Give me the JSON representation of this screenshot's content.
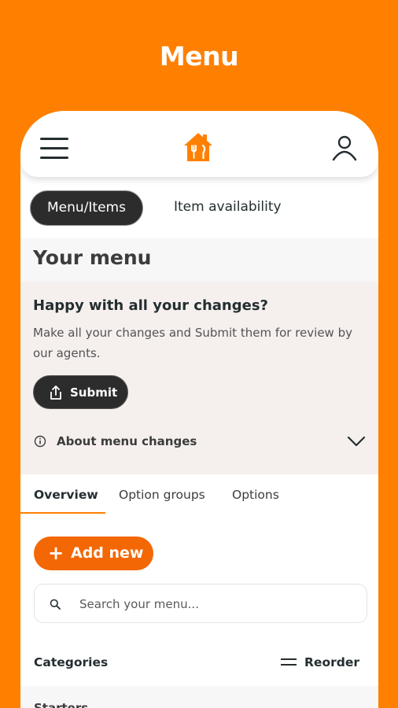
{
  "banner": {
    "title": "Menu"
  },
  "header": {
    "menu_icon": "hamburger-icon",
    "logo_icon": "house-cutlery-logo",
    "account_icon": "user-icon"
  },
  "segments": {
    "menu_items": "Menu/Items",
    "availability": "Item availability"
  },
  "page": {
    "title": "Your menu"
  },
  "review": {
    "title": "Happy with all your changes?",
    "body": "Make all your changes and Submit them for review by our agents.",
    "submit_label": "Submit",
    "about_label": "About menu changes"
  },
  "tabs": [
    {
      "label": "Overview",
      "active": true
    },
    {
      "label": "Option groups",
      "active": false
    },
    {
      "label": "Options",
      "active": false
    }
  ],
  "actions": {
    "add_new_label": "Add new"
  },
  "search": {
    "placeholder": "Search your menu..."
  },
  "categories": {
    "header": "Categories",
    "reorder_label": "Reorder",
    "items": [
      {
        "label": "Starters"
      }
    ]
  },
  "colors": {
    "brand_orange": "#FF8000",
    "button_orange": "#F36805",
    "dark": "#2c2c2c",
    "card_bg": "#F5F0EE"
  }
}
